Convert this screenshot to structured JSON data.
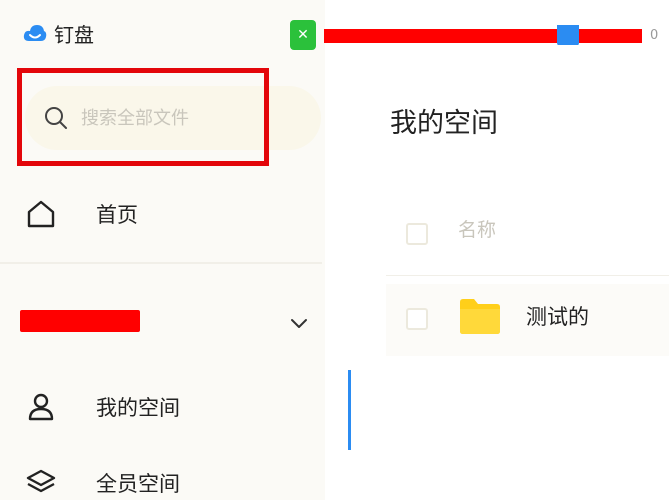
{
  "app": {
    "name": "钉盘"
  },
  "tab": {
    "suffix": "0"
  },
  "search": {
    "placeholder": "搜索全部文件"
  },
  "nav": {
    "home": "首页",
    "my_space": "我的空间",
    "all_space": "全员空间"
  },
  "workspace_section": {
    "caret_icon": "chevron-down-icon"
  },
  "main": {
    "title": "我的空间",
    "columns": {
      "name": "名称"
    },
    "files": [
      {
        "name": "测试的",
        "type": "folder"
      }
    ]
  },
  "colors": {
    "accent_blue": "#2b8cf2",
    "folder_yellow": "#ffcf1a",
    "excel_green": "#2bc13b",
    "annotation_red": "#e3060a"
  }
}
